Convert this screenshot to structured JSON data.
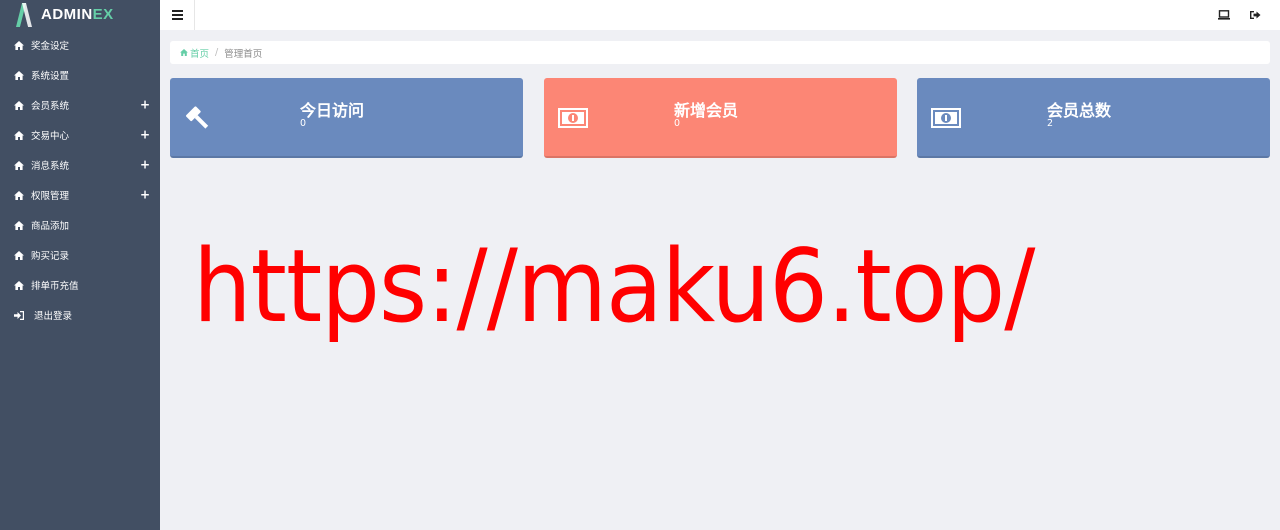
{
  "brand": {
    "name_main": "ADMIN",
    "name_accent": "EX"
  },
  "sidebar": {
    "items": [
      {
        "label": "奖金设定",
        "icon": "home-icon",
        "expandable": false
      },
      {
        "label": "系统设置",
        "icon": "home-icon",
        "expandable": false
      },
      {
        "label": "会员系统",
        "icon": "home-icon",
        "expandable": true,
        "toggle": "+"
      },
      {
        "label": "交易中心",
        "icon": "home-icon",
        "expandable": true,
        "toggle": "+"
      },
      {
        "label": "消息系统",
        "icon": "home-icon",
        "expandable": true,
        "toggle": "+"
      },
      {
        "label": "权限管理",
        "icon": "home-icon",
        "expandable": true,
        "toggle": "+"
      },
      {
        "label": "商品添加",
        "icon": "home-icon",
        "expandable": false
      },
      {
        "label": "购买记录",
        "icon": "home-icon",
        "expandable": false
      },
      {
        "label": "排单币充值",
        "icon": "home-icon",
        "expandable": false
      },
      {
        "label": "退出登录",
        "icon": "sign-in-icon",
        "expandable": false
      }
    ]
  },
  "header": {
    "toggle_icon": "menu-icon",
    "right_icons": [
      "monitor-icon",
      "sign-out-icon"
    ]
  },
  "breadcrumb": {
    "home": "首页",
    "separator": "/",
    "current": "管理首页"
  },
  "cards": [
    {
      "title": "今日访问",
      "value": "0",
      "icon": "gavel-icon",
      "color": "#6a8abe"
    },
    {
      "title": "新增会员",
      "value": "0",
      "icon": "money-icon",
      "color": "#fc8675"
    },
    {
      "title": "会员总数",
      "value": "2",
      "icon": "money-icon",
      "color": "#6a8abe"
    }
  ],
  "watermark": {
    "text": "https://maku6.top/",
    "color": "#ff0000"
  },
  "colors": {
    "sidebar_bg": "#424f63",
    "accent": "#65cea7",
    "page_bg": "#eff0f4"
  }
}
